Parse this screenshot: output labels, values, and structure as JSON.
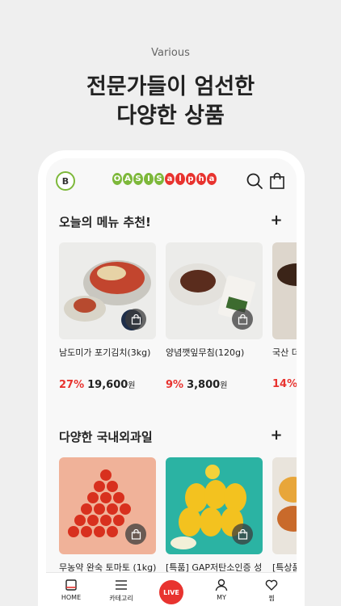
{
  "promo": {
    "kicker": "Various",
    "headline_line1": "전문가들이 엄선한",
    "headline_line2": "다양한 상품"
  },
  "app": {
    "badge": "B",
    "logo_letters": [
      "O",
      "A",
      "S",
      "I",
      "S",
      "a",
      "l",
      "p",
      "h",
      "a"
    ],
    "logo_text": "OASISalpha",
    "icons": [
      "search-icon",
      "shopping-bag-icon"
    ]
  },
  "sections": [
    {
      "title": "오늘의 메뉴 추천!",
      "plus": "+",
      "products": [
        {
          "name": "남도미가 포기김치(3kg)",
          "discount": "27%",
          "price": "19,600",
          "unit": "원"
        },
        {
          "name": "양념깻잎무침(120g)",
          "discount": "9%",
          "price": "3,800",
          "unit": "원"
        },
        {
          "name": "국산 더",
          "discount": "14%",
          "price": "",
          "unit": ""
        }
      ]
    },
    {
      "title": "다양한 국내외과일",
      "plus": "+",
      "products": [
        {
          "name": "무농약 완숙 토마토 (1kg)"
        },
        {
          "name": "[특품] GAP저탄소인증 성"
        },
        {
          "name": "[특상품"
        }
      ]
    }
  ],
  "tabbar": [
    {
      "label": "HOME",
      "icon": "home-icon"
    },
    {
      "label": "카테고리",
      "icon": "menu-icon"
    },
    {
      "label": "LIVE",
      "icon": "live-icon"
    },
    {
      "label": "MY",
      "icon": "person-icon"
    },
    {
      "label": "찜",
      "icon": "heart-icon"
    }
  ],
  "colors": {
    "brand_green": "#7db83a",
    "brand_red": "#e8332f",
    "background": "#efefef"
  }
}
